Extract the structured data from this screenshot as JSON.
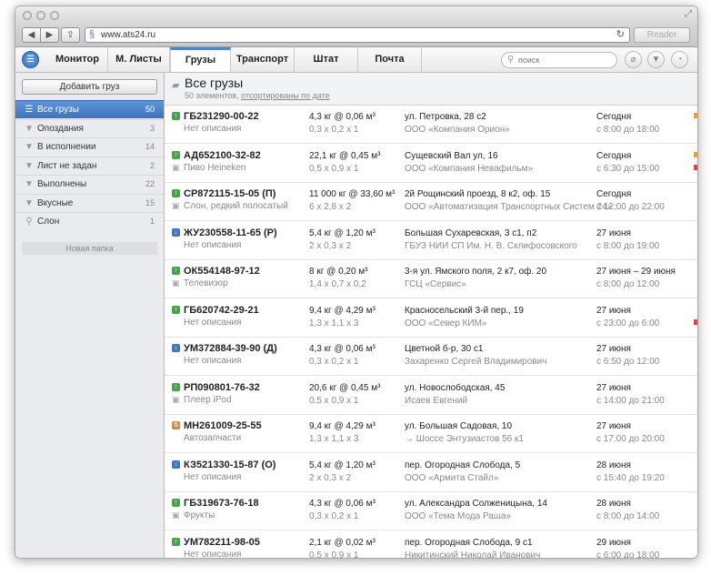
{
  "browser": {
    "url": "www.ats24.ru",
    "reader_label": "Reader"
  },
  "app": {
    "tabs": [
      {
        "label": "Монитор"
      },
      {
        "label": "М. Листы"
      },
      {
        "label": "Грузы",
        "active": true
      },
      {
        "label": "Транспорт"
      },
      {
        "label": "Штат"
      },
      {
        "label": "Почта"
      }
    ],
    "search_placeholder": "поиск"
  },
  "sidebar": {
    "add_button": "Добавить груз",
    "items": [
      {
        "label": "Все грузы",
        "count": "50",
        "icon": "list-icon",
        "selected": true
      },
      {
        "label": "Опоздания",
        "count": "3",
        "icon": "filter-icon"
      },
      {
        "label": "В исполнении",
        "count": "14",
        "icon": "filter-icon"
      },
      {
        "label": "Лист не задан",
        "count": "2",
        "icon": "filter-icon"
      },
      {
        "label": "Выполнены",
        "count": "22",
        "icon": "filter-icon"
      },
      {
        "label": "Вкусные",
        "count": "15",
        "icon": "filter-icon"
      },
      {
        "label": "Слон",
        "count": "1",
        "icon": "search-icon"
      }
    ],
    "new_folder": "Новая папка"
  },
  "main": {
    "title": "Все грузы",
    "subtitle_count": "50 элементов,",
    "subtitle_sort": "отсортированы по дате",
    "rows": [
      {
        "status": "green",
        "id": "ГБ231290-00-22",
        "desc": "Нет описания",
        "cam": false,
        "weight": "4,3 кг @ 0,06 м³",
        "dims": "0,3 х 0,2 х 1",
        "addr": "ул. Петровка, 28 с2",
        "org": "ООО «Компания Орион»",
        "date": "Сегодня",
        "time": "с 8:00 до 18:00",
        "mark1": "#f0a030",
        "mark2": ""
      },
      {
        "status": "green",
        "id": "АД652100-32-82",
        "desc": "Пиво Heineken",
        "cam": true,
        "weight": "22,1 кг @ 0,45 м³",
        "dims": "0,5 х 0,9 х 1",
        "addr": "Сущевский Вал ул, 16",
        "org": "ООО «Компания Невафильм»",
        "date": "Сегодня",
        "time": "с 6:30 до 15:00",
        "mark1": "#f0a030",
        "mark2": "#e04040"
      },
      {
        "status": "green",
        "id": "СР872115-15-05 (П)",
        "desc": "Слон, редкий полосатый",
        "cam": true,
        "weight": "11 000 кг @ 33,60 м³",
        "dims": "6 х 2,8 х 2",
        "addr": "2й Рощинский проезд, 8 к2, оф. 15",
        "org": "ООО «Автоматизация Транспортных Систем 24»",
        "date": "Сегодня",
        "time": "с 12:00 до 22:00",
        "mark1": "",
        "mark2": ""
      },
      {
        "status": "blue",
        "id": "ЖУ230558-11-65 (Р)",
        "desc": "Нет описания",
        "cam": false,
        "weight": "5,4 кг @ 1,20 м³",
        "dims": "2 х 0,3 х 2",
        "addr": "Большая Сухаревская, 3 с1, п2",
        "org": "ГБУЗ НИИ СП Им. Н. В. Склифосовского",
        "date": "27 июня",
        "time": "с 8:00 до 19:00",
        "mark1": "",
        "mark2": ""
      },
      {
        "status": "green",
        "id": "ОК554148-97-12",
        "desc": "Телевизор",
        "cam": true,
        "weight": "8 кг @ 0,20 м³",
        "dims": "1,4 х 0,7 х 0,2",
        "addr": "3-я ул. Ямского поля, 2 к7, оф. 20",
        "org": "ГСЦ «Сервис»",
        "date": "27 июня – 29 июня",
        "time": "с 8:00 до 12:00",
        "mark1": "",
        "mark2": ""
      },
      {
        "status": "green",
        "id": "ГБ620742-29-21",
        "desc": "Нет описания",
        "cam": false,
        "weight": "9,4 кг @ 4,29 м³",
        "dims": "1,3 х 1,1 х 3",
        "addr": "Красносельский 3-й пер., 19",
        "org": "ООО «Север КИМ»",
        "date": "27 июня",
        "time": "с 23:00 до 6:00",
        "mark1": "",
        "mark2": "#e04040"
      },
      {
        "status": "blue",
        "id": "УМ372884-39-90 (Д)",
        "desc": "Нет описания",
        "cam": false,
        "weight": "4,3 кг @ 0,06 м³",
        "dims": "0,3 х 0,2 х 1",
        "addr": "Цветной б-р, 30 с1",
        "org": "Захаренко Сергей Владимирович",
        "date": "27 июня",
        "time": "с 6:50 до 12:00",
        "mark1": "",
        "mark2": ""
      },
      {
        "status": "green",
        "id": "РП090801-76-32",
        "desc": "Плеер iPod",
        "cam": true,
        "weight": "20,6 кг @ 0,45 м³",
        "dims": "0.5 х 0,9 х 1",
        "addr": "ул. Новослободская, 45",
        "org": "Исаев Евгений",
        "date": "27 июня",
        "time": "с 14:00 до 21:00",
        "mark1": "",
        "mark2": ""
      },
      {
        "status": "orange",
        "id": "МН261009-25-55",
        "desc": "Автозапчасти",
        "cam": false,
        "weight": "9,4 кг @ 4,29 м³",
        "dims": "1,3 х 1,1 х 3",
        "addr": "ул. Большая Садовая, 10",
        "org": "→ Шоссе Энтузиастов 56 к1",
        "date": "27 июня",
        "time": "с 17:00 до 20:00",
        "mark1": "",
        "mark2": ""
      },
      {
        "status": "blue",
        "id": "КЗ521330-15-87 (О)",
        "desc": "Нет описания",
        "cam": false,
        "weight": "5,4 кг @ 1,20 м³",
        "dims": "2 х 0,3 х 2",
        "addr": "пер. Огородная Слобода, 5",
        "org": "ООО «Армита Стайл»",
        "date": "28 июня",
        "time": "с 15:40 до 19:20",
        "mark1": "",
        "mark2": ""
      },
      {
        "status": "green",
        "id": "ГБ319673-76-18",
        "desc": "Фрукты",
        "cam": true,
        "weight": "4,3 кг @ 0,06 м³",
        "dims": "0,3 х 0,2 х 1",
        "addr": "ул. Александра Солженицына, 14",
        "org": "ООО «Тема Мода Раша»",
        "date": "28 июня",
        "time": "с 8:00 до 14:00",
        "mark1": "",
        "mark2": ""
      },
      {
        "status": "green",
        "id": "УМ782211-98-05",
        "desc": "Нет описания",
        "cam": false,
        "weight": "2,1 кг @ 0,02 м³",
        "dims": "0,5 х 0,9 х 1",
        "addr": "пер. Огородная Слобода, 9 с1",
        "org": "Никитинский Николай Иванович",
        "date": "29 июня",
        "time": "с 6:00 до 18:00",
        "mark1": "",
        "mark2": ""
      }
    ]
  },
  "colors": {
    "accent": "#4a86d2",
    "status_green": "#43a648",
    "status_blue": "#3c78c8",
    "status_orange": "#e8832a"
  }
}
